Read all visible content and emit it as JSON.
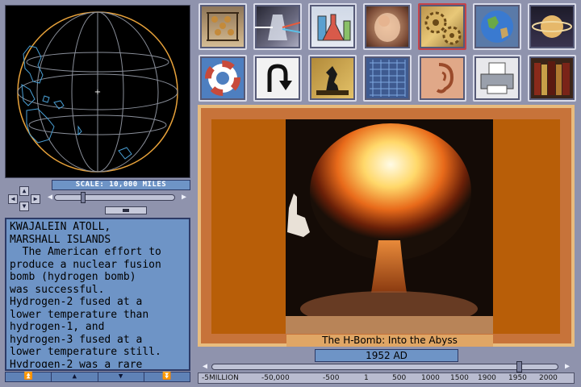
{
  "globe": {
    "scale_label": "SCALE: 10,000 MILES"
  },
  "text_panel": {
    "body": "KWAJALEIN ATOLL,\nMARSHALL ISLANDS\n  The American effort to\nproduce a nuclear fusion\nbomb (hydrogen bomb)\nwas successful.\nHydrogen-2 fused at a\nlower temperature than\nhydrogen-1, and\nhydrogen-3 fused at a\nlower temperature still.\nHydrogen-2 was a rare",
    "scroll_buttons": [
      "⏫",
      "▲",
      "▼",
      "⏬"
    ]
  },
  "toolbar": {
    "row1": [
      {
        "name": "abacus-icon",
        "emoji": "🧮"
      },
      {
        "name": "prism-icon",
        "emoji": "🔦"
      },
      {
        "name": "flasks-icon",
        "emoji": "⚗"
      },
      {
        "name": "fetus-icon",
        "emoji": "👶"
      },
      {
        "name": "gears-icon",
        "emoji": "⚙"
      },
      {
        "name": "earth-icon",
        "emoji": "🌍"
      },
      {
        "name": "saturn-icon",
        "emoji": "🪐"
      }
    ],
    "row2": [
      {
        "name": "life-preserver-icon",
        "emoji": "🛟"
      },
      {
        "name": "u-turn-icon",
        "emoji": "⮌"
      },
      {
        "name": "chess-icon",
        "emoji": "♞"
      },
      {
        "name": "grid-icon",
        "emoji": "▦"
      },
      {
        "name": "ear-icon",
        "emoji": "👂"
      },
      {
        "name": "printer-icon",
        "emoji": "🖨"
      },
      {
        "name": "books-icon",
        "emoji": "📚"
      }
    ]
  },
  "image": {
    "caption": "The H-Bomb: Into the Abyss"
  },
  "timeline": {
    "date": "1952 AD",
    "ticks": [
      "-5MILLION",
      "-50,000",
      "-500",
      "1",
      "500",
      "1000",
      "1500",
      "1900",
      "1950",
      "2000"
    ]
  }
}
